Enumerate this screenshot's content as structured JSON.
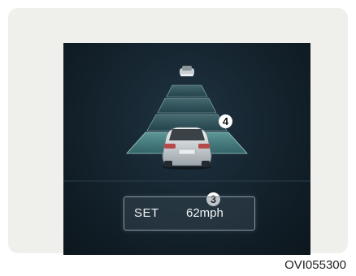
{
  "display": {
    "set_label": "SET",
    "set_speed": "62mph",
    "callout_distance": "4",
    "callout_speed": "3",
    "distance_bars_count": 4
  },
  "caption": "OVI055300",
  "icons": {
    "lead_vehicle": "car-ahead-icon",
    "own_vehicle": "own-car-icon"
  },
  "colors": {
    "screen_bg": "#14222c",
    "distance_bar": "#4f8a8c",
    "panel_bg": "#efefec"
  }
}
